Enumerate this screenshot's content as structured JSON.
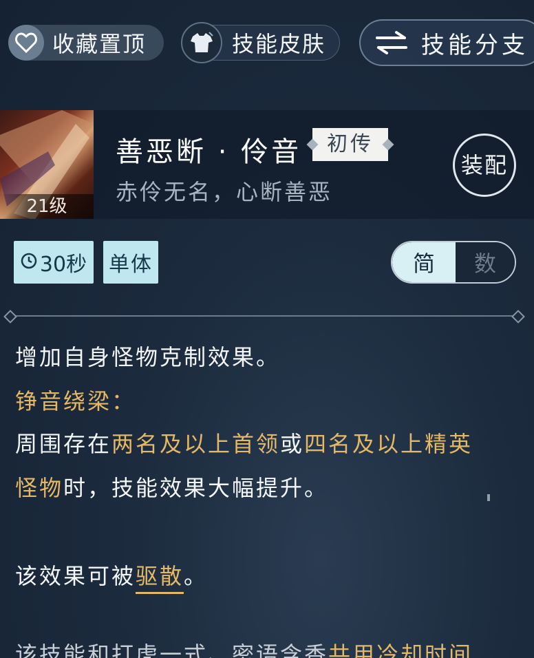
{
  "topbar": {
    "favorite_label": "收藏置顶",
    "skin_label": "技能皮肤",
    "branch_label": "技能分支"
  },
  "skill": {
    "name": "善恶断 · 伶音",
    "tier": "初传",
    "subtitle": "赤伶无名，心断善恶",
    "level": "21级",
    "equip_label": "装配"
  },
  "tags": {
    "cooldown": "30秒",
    "target": "单体"
  },
  "mode_toggle": {
    "active": "简",
    "inactive": "数"
  },
  "description": {
    "line1": "增加自身怪物克制效果。",
    "line2": "铮音绕梁：",
    "line3_a": "周围存在",
    "line3_b": "两名及以上首领",
    "line3_c": "或",
    "line3_d": "四名及以上精英",
    "line4_a": "怪物",
    "line4_b": "时，技能效果大幅提升。",
    "line5_a": "该效果可被",
    "line5_b": "驱散",
    "line5_c": "。",
    "line6_a": "该技能和打虎一式、密语含香",
    "line6_b": "共用冷却时间"
  },
  "colors": {
    "highlight": "#e5b866",
    "tag_bg": "#bfe7ef",
    "background": "#1b2a3c"
  }
}
